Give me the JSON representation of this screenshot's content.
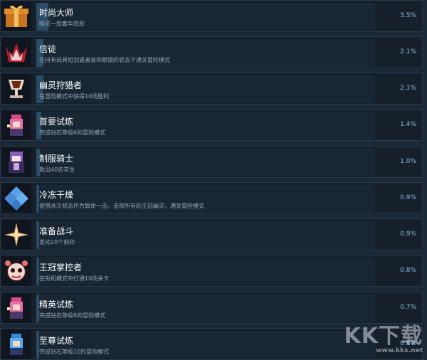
{
  "achievements": [
    {
      "title": "时尚大师",
      "desc": "购买一款奢华皮肤",
      "percent": "3.5%",
      "progress": 0.035,
      "icon": "gift-box-icon"
    },
    {
      "title": "信徒",
      "desc": "在持有玩具短剑或者装饰眼镜的状态下通关冒险模式",
      "percent": "2.1%",
      "progress": 0.021,
      "icon": "red-crown-icon"
    },
    {
      "title": "幽灵狩猎者",
      "desc": "在冒险模式中获得10场胜利",
      "percent": "2.1%",
      "progress": 0.021,
      "icon": "trophy-cup-icon"
    },
    {
      "title": "首要试炼",
      "desc": "完成钻石等级6的冒险模式",
      "percent": "1.4%",
      "progress": 0.014,
      "icon": "pink-hero-icon"
    },
    {
      "title": "制服骑士",
      "desc": "救出40名学生",
      "percent": "1.0%",
      "progress": 0.01,
      "icon": "purple-knight-icon"
    },
    {
      "title": "冷冻干燥",
      "desc": "使用冰冷状态作为致命一击，击败所有的王冠幽灵，通关冒险模式",
      "percent": "0.9%",
      "progress": 0.009,
      "icon": "ice-crystal-icon"
    },
    {
      "title": "准备战斗",
      "desc": "发动20个刻印",
      "percent": "0.9%",
      "progress": 0.009,
      "icon": "gold-star-icon"
    },
    {
      "title": "王冠掌控者",
      "desc": "在街机模式中打通10场关卡",
      "percent": "0.8%",
      "progress": 0.008,
      "icon": "crown-ghost-icon"
    },
    {
      "title": "精英试炼",
      "desc": "完成钻石等级8的冒险模式",
      "percent": "0.7%",
      "progress": 0.007,
      "icon": "pink-hero-icon"
    },
    {
      "title": "至尊试炼",
      "desc": "完成钻石等级10的冒险模式",
      "percent": "0.6%",
      "progress": 0.006,
      "icon": "blue-hero-icon"
    }
  ],
  "watermark": {
    "logo": "KK下载",
    "url": "www.kkx.net"
  }
}
